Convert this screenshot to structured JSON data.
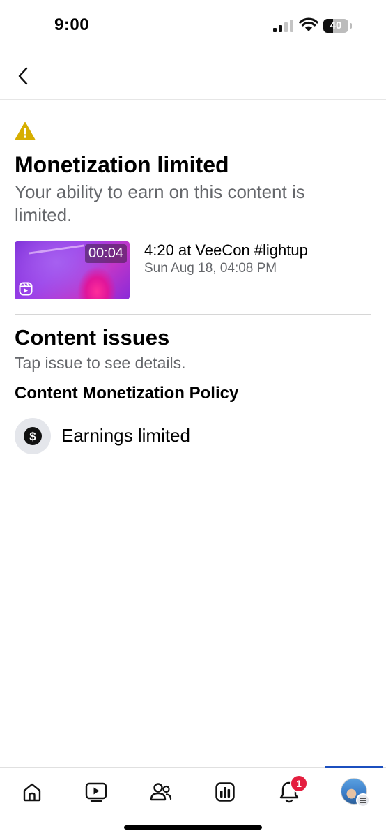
{
  "status_bar": {
    "time": "9:00",
    "battery_level": "40"
  },
  "header": {
    "back_icon": "chevron-left-icon"
  },
  "monetization": {
    "icon": "warning-icon",
    "icon_color": "#D6AE00",
    "title": "Monetization limited",
    "subtitle": "Your ability to earn on this content is limited."
  },
  "content": {
    "thumbnail_duration": "00:04",
    "thumbnail_badge_icon": "reels-icon",
    "title": "4:20 at VeeCon #lightup",
    "date": "Sun Aug 18, 04:08 PM"
  },
  "issues": {
    "title": "Content issues",
    "subtitle": "Tap issue to see details.",
    "policy_heading": "Content Monetization Policy",
    "items": [
      {
        "icon": "dollar-circle-icon",
        "label": "Earnings limited"
      }
    ]
  },
  "tab_bar": {
    "tabs": [
      {
        "icon": "home-icon"
      },
      {
        "icon": "video-icon"
      },
      {
        "icon": "friends-icon"
      },
      {
        "icon": "insights-icon"
      },
      {
        "icon": "bell-icon",
        "badge": "1"
      },
      {
        "icon": "profile-avatar",
        "active": true
      }
    ],
    "accent": "#1B4FBF",
    "badge_color": "#E41E3F"
  }
}
